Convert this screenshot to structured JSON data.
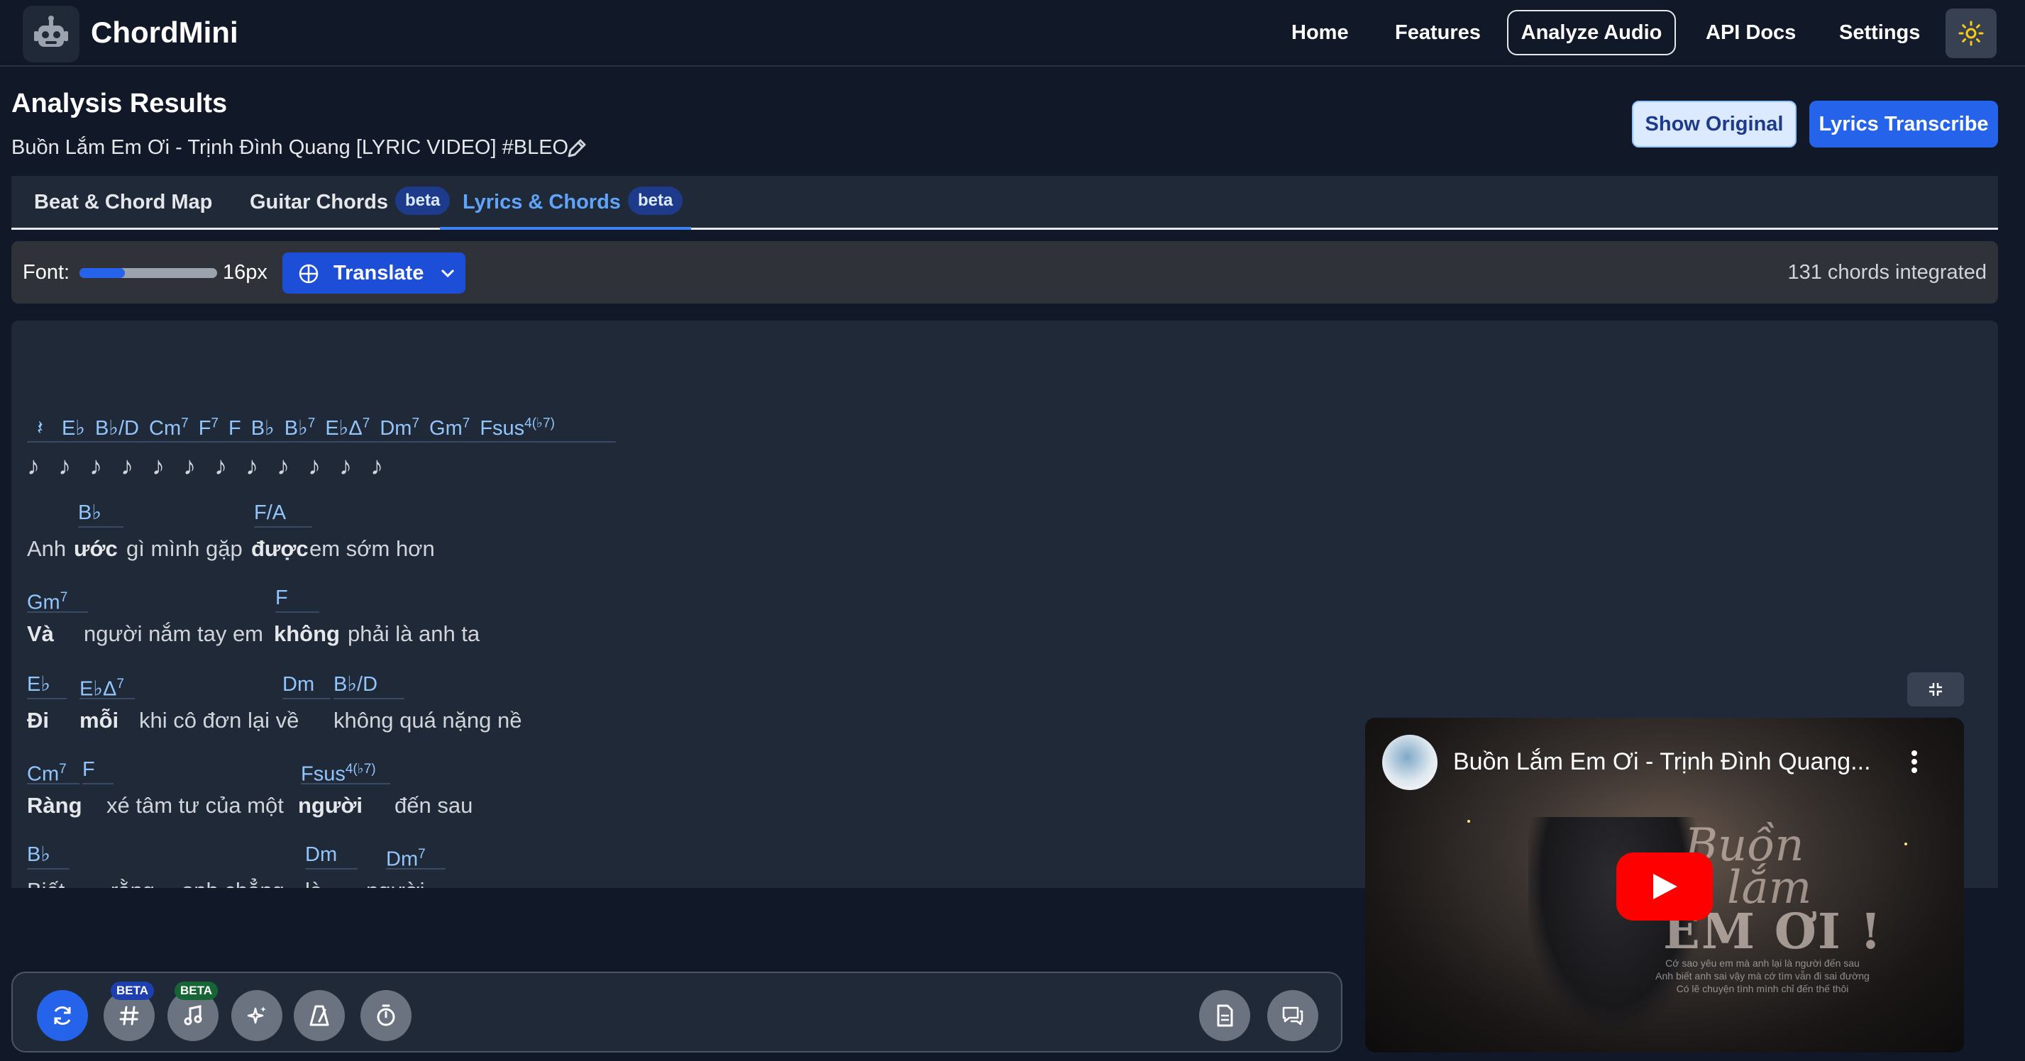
{
  "header": {
    "brand": "ChordMini",
    "nav": [
      "Home",
      "Features",
      "Analyze Audio",
      "API Docs",
      "Settings"
    ],
    "active_nav": "Analyze Audio",
    "logo_icon": "robot-icon",
    "theme_icon": "sun-icon"
  },
  "results": {
    "title": "Analysis Results",
    "song_title": "Buồn Lắm Em Ơi - Trịnh Đình Quang [LYRIC VIDEO] #BLEO",
    "show_original": "Show Original",
    "lyrics_transcribe": "Lyrics Transcribe"
  },
  "tabs": [
    {
      "label": "Beat & Chord Map",
      "badge": ""
    },
    {
      "label": "Guitar Chords",
      "badge": "beta"
    },
    {
      "label": "Lyrics & Chords",
      "badge": "beta"
    }
  ],
  "controls": {
    "font_label": "Font:",
    "font_size": "16px",
    "font_slider_fraction": 0.33,
    "translate_label": "Translate",
    "chord_count": "131 chords integrated"
  },
  "intro": {
    "rest": "𝄽",
    "chords": [
      "E♭",
      "B♭/D",
      "Cm",
      "F",
      "F",
      "B♭",
      "B♭",
      "E♭Δ",
      "Dm",
      "Gm",
      "Fsus"
    ],
    "sups": [
      "",
      "",
      "7",
      "7",
      "",
      "",
      "7",
      "7",
      "7",
      "7",
      "4(♭7)"
    ],
    "notes": "♪ ♪ ♪ ♪ ♪ ♪ ♪ ♪ ♪ ♪ ♪ ♪"
  },
  "lines": [
    {
      "chords": [
        {
          "c": "B♭",
          "s": ""
        },
        {
          "c": "F/A",
          "s": ""
        }
      ],
      "words": [
        "Anh",
        "ước",
        "gì mình gặp",
        "được",
        "em sớm hơn"
      ]
    },
    {
      "chords": [
        {
          "c": "Gm",
          "s": "7"
        },
        {
          "c": "F",
          "s": ""
        }
      ],
      "words": [
        "Và",
        "người nắm tay em",
        "không",
        "phải là anh ta"
      ]
    },
    {
      "chords": [
        {
          "c": "E♭",
          "s": ""
        },
        {
          "c": "E♭Δ",
          "s": "7"
        },
        {
          "c": "Dm",
          "s": ""
        },
        {
          "c": "B♭/D",
          "s": ""
        }
      ],
      "words": [
        "Đi",
        "mỗi",
        "khi cô đơn lại về",
        "không quá nặng nề"
      ]
    },
    {
      "chords": [
        {
          "c": "Cm",
          "s": "7"
        },
        {
          "c": "F",
          "s": ""
        },
        {
          "c": "Fsus",
          "s": "4(♭7)"
        }
      ],
      "words": [
        "Ràng",
        "xé tâm tư của một",
        "người",
        "đến sau"
      ]
    },
    {
      "chords": [
        {
          "c": "B♭",
          "s": ""
        },
        {
          "c": "Dm",
          "s": ""
        },
        {
          "c": "Dm",
          "s": "7"
        }
      ],
      "words": [
        "Biết",
        "rằng",
        "anh chẳng",
        "là",
        "người"
      ]
    }
  ],
  "toolbar": {
    "buttons": [
      "refresh-icon",
      "hash-icon",
      "music-note-icon",
      "sparkles-icon",
      "metronome-icon",
      "timer-icon",
      "document-icon",
      "chat-icon"
    ],
    "beta_label": "BETA"
  },
  "video": {
    "title": "Buồn Lắm Em Ơi - Trịnh Đình Quang...",
    "art_script_1": "Buồn",
    "art_script_2": "lắm",
    "art_big": "EM ƠI !",
    "art_line_1": "Cớ sao yêu em mà anh lại là người đến sau",
    "art_line_2": "Anh biết anh sai vậy mà cớ tìm vẫn đi sai đường",
    "art_line_3": "Có lẽ chuyện tình mình chỉ đến thế thôi"
  }
}
